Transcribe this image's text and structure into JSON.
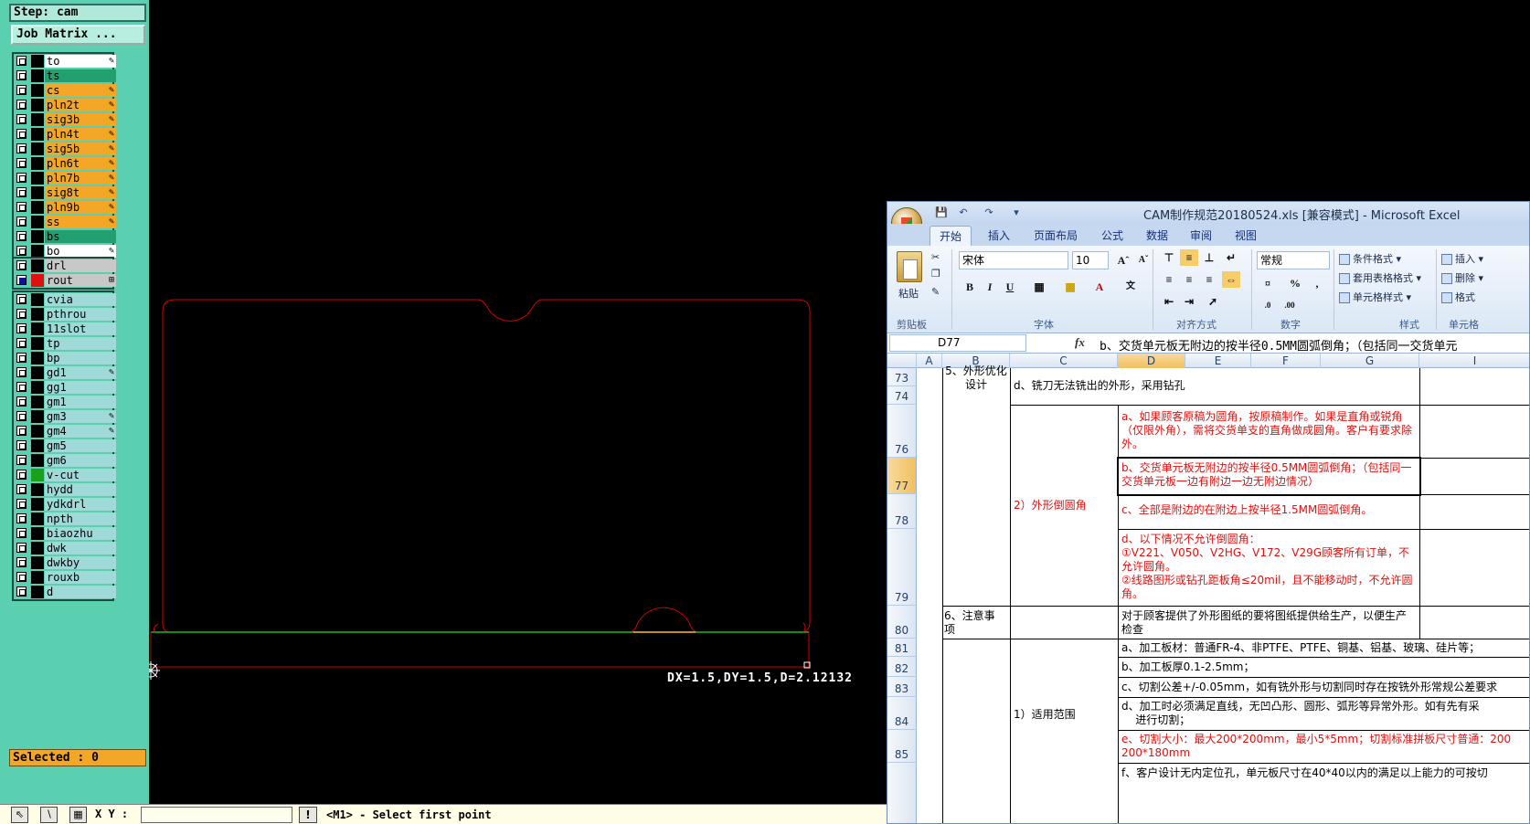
{
  "cam": {
    "step_label": "Step: cam",
    "job_matrix_label": "Job Matrix ...",
    "layer_groups": [
      [
        {
          "name": "to",
          "color": "white",
          "flag": "✎"
        },
        {
          "name": "ts",
          "color": "teal",
          "flag": ""
        },
        {
          "name": "cs",
          "color": "orange",
          "flag": "✎"
        },
        {
          "name": "pln2t",
          "color": "orange",
          "flag": "✎"
        },
        {
          "name": "sig3b",
          "color": "orange",
          "flag": "✎"
        },
        {
          "name": "pln4t",
          "color": "orange",
          "flag": "✎"
        },
        {
          "name": "sig5b",
          "color": "orange",
          "flag": "✎"
        },
        {
          "name": "pln6t",
          "color": "orange",
          "flag": "✎"
        },
        {
          "name": "pln7b",
          "color": "orange",
          "flag": "✎"
        },
        {
          "name": "sig8t",
          "color": "orange",
          "flag": "✎"
        },
        {
          "name": "pln9b",
          "color": "orange",
          "flag": "✎"
        },
        {
          "name": "ss",
          "color": "orange",
          "flag": "✎"
        },
        {
          "name": "bs",
          "color": "teal",
          "flag": ""
        },
        {
          "name": "bo",
          "color": "white",
          "flag": "✎"
        }
      ],
      [
        {
          "name": "drl",
          "color": "grey",
          "flag": ""
        },
        {
          "name": "rout",
          "color": "grey",
          "flag": "⊞",
          "active": true,
          "swatch": "#e01010"
        }
      ],
      [
        {
          "name": "cvia",
          "color": "light",
          "flag": ""
        },
        {
          "name": "pthrou",
          "color": "light",
          "flag": ""
        },
        {
          "name": "11slot",
          "color": "light",
          "flag": ""
        },
        {
          "name": "tp",
          "color": "light",
          "flag": ""
        },
        {
          "name": "bp",
          "color": "light",
          "flag": ""
        },
        {
          "name": "gd1",
          "color": "light",
          "flag": "✎"
        },
        {
          "name": "gg1",
          "color": "light",
          "flag": ""
        },
        {
          "name": "gm1",
          "color": "light",
          "flag": ""
        },
        {
          "name": "gm3",
          "color": "light",
          "flag": "✎"
        },
        {
          "name": "gm4",
          "color": "light",
          "flag": "✎"
        },
        {
          "name": "gm5",
          "color": "light",
          "flag": ""
        },
        {
          "name": "gm6",
          "color": "light",
          "flag": ""
        },
        {
          "name": "v-cut",
          "color": "light",
          "flag": "",
          "swatch": "#1aa01a"
        },
        {
          "name": "hydd",
          "color": "light",
          "flag": ""
        },
        {
          "name": "ydkdrl",
          "color": "light",
          "flag": ""
        },
        {
          "name": "npth",
          "color": "light",
          "flag": ""
        },
        {
          "name": "biaozhu",
          "color": "light",
          "flag": ""
        },
        {
          "name": "dwk",
          "color": "light",
          "flag": ""
        },
        {
          "name": "dwkby",
          "color": "light",
          "flag": ""
        },
        {
          "name": "rouxb",
          "color": "light",
          "flag": ""
        },
        {
          "name": "d",
          "color": "light",
          "flag": ""
        }
      ]
    ],
    "selected_label": "Selected : 0",
    "measure_text": "DX=1.5,DY=1.5,D=2.12132",
    "status": {
      "xy_label": "X Y :",
      "prompt": "<M1> - Select first point",
      "excl": "!"
    }
  },
  "excel": {
    "title": "CAM制作规范20180524.xls  [兼容模式] - Microsoft Excel",
    "tabs": [
      "开始",
      "插入",
      "页面布局",
      "公式",
      "数据",
      "审阅",
      "视图"
    ],
    "ribbon": {
      "paste": "粘贴",
      "clipboard": "剪贴板",
      "font_name": "宋体",
      "font_size": "10",
      "font_group": "字体",
      "align_group": "对齐方式",
      "number_format": "常规",
      "number_group": "数字",
      "cond_format": "条件格式",
      "table_format": "套用表格格式",
      "cell_style": "单元格样式",
      "style_group": "样式",
      "insert": "插入",
      "delete": "删除",
      "format": "格式",
      "cells_group": "单元格"
    },
    "name_box": "D77",
    "formula": "b、交货单元板无附边的按半径0.5MM圆弧倒角；（包括同一交货单元",
    "columns": [
      "A",
      "B",
      "C",
      "D",
      "E",
      "F",
      "G",
      "I"
    ],
    "rows": [
      "73",
      "74",
      "76",
      "77",
      "78",
      "79",
      "80",
      "81",
      "82",
      "83",
      "84",
      "85"
    ],
    "cells": {
      "b73": "5、外形优化\n设计",
      "c73": "d、铣刀无法铣出的外形，采用钻孔",
      "d76": "a、如果顾客原稿为圆角，按原稿制作。如果是直角或锐角（仅限外角），需将交货单支的直角做成圆角。客户有要求除外。",
      "d77": "b、交货单元板无附边的按半径0.5MM圆弧倒角；（包括同一交货单元板一边有附边一边无附边情况）",
      "c78": "2）外形倒圆角",
      "d78": "c、全部是附边的在附边上按半径1.5MM圆弧倒角。",
      "d79": "d、以下情况不允许倒圆角：\n①V221、V050、V2HG、V172、V29G顾客所有订单，不允许圆角。\n②线路图形或钻孔距板角≤20mil，且不能移动时，不允许圆角。",
      "b80": "6、注意事\n项",
      "d80": "对于顾客提供了外形图纸的要将图纸提供给生产，以便生产检查",
      "d81": "a、加工板材：普通FR-4、非PTFE、PTFE、铜基、铝基、玻璃、硅片等；",
      "d82": "b、加工板厚0.1-2.5mm；",
      "d83": "c、切割公差+/-0.05mm，如有铣外形与切割同时存在按铣外形常规公差要求",
      "c84": "1）适用范围",
      "d84": "d、加工时必须满足直线，无凹凸形、圆形、弧形等异常外形。如有先有采\n    进行切割；",
      "d85": "e、切割大小：最大200*200mm，最小5*5mm；切割标准拼板尺寸普通：200\n200*180mm",
      "d86": "f、客户设计无内定位孔，单元板尺寸在40*40以内的满足以上能力的可按切"
    }
  },
  "colors": {
    "outline": "#d40000",
    "vcut": "#22b522",
    "panel_bg": "#5ad0b0",
    "layer_orange": "#f4a626",
    "layer_teal": "#22a06f"
  }
}
